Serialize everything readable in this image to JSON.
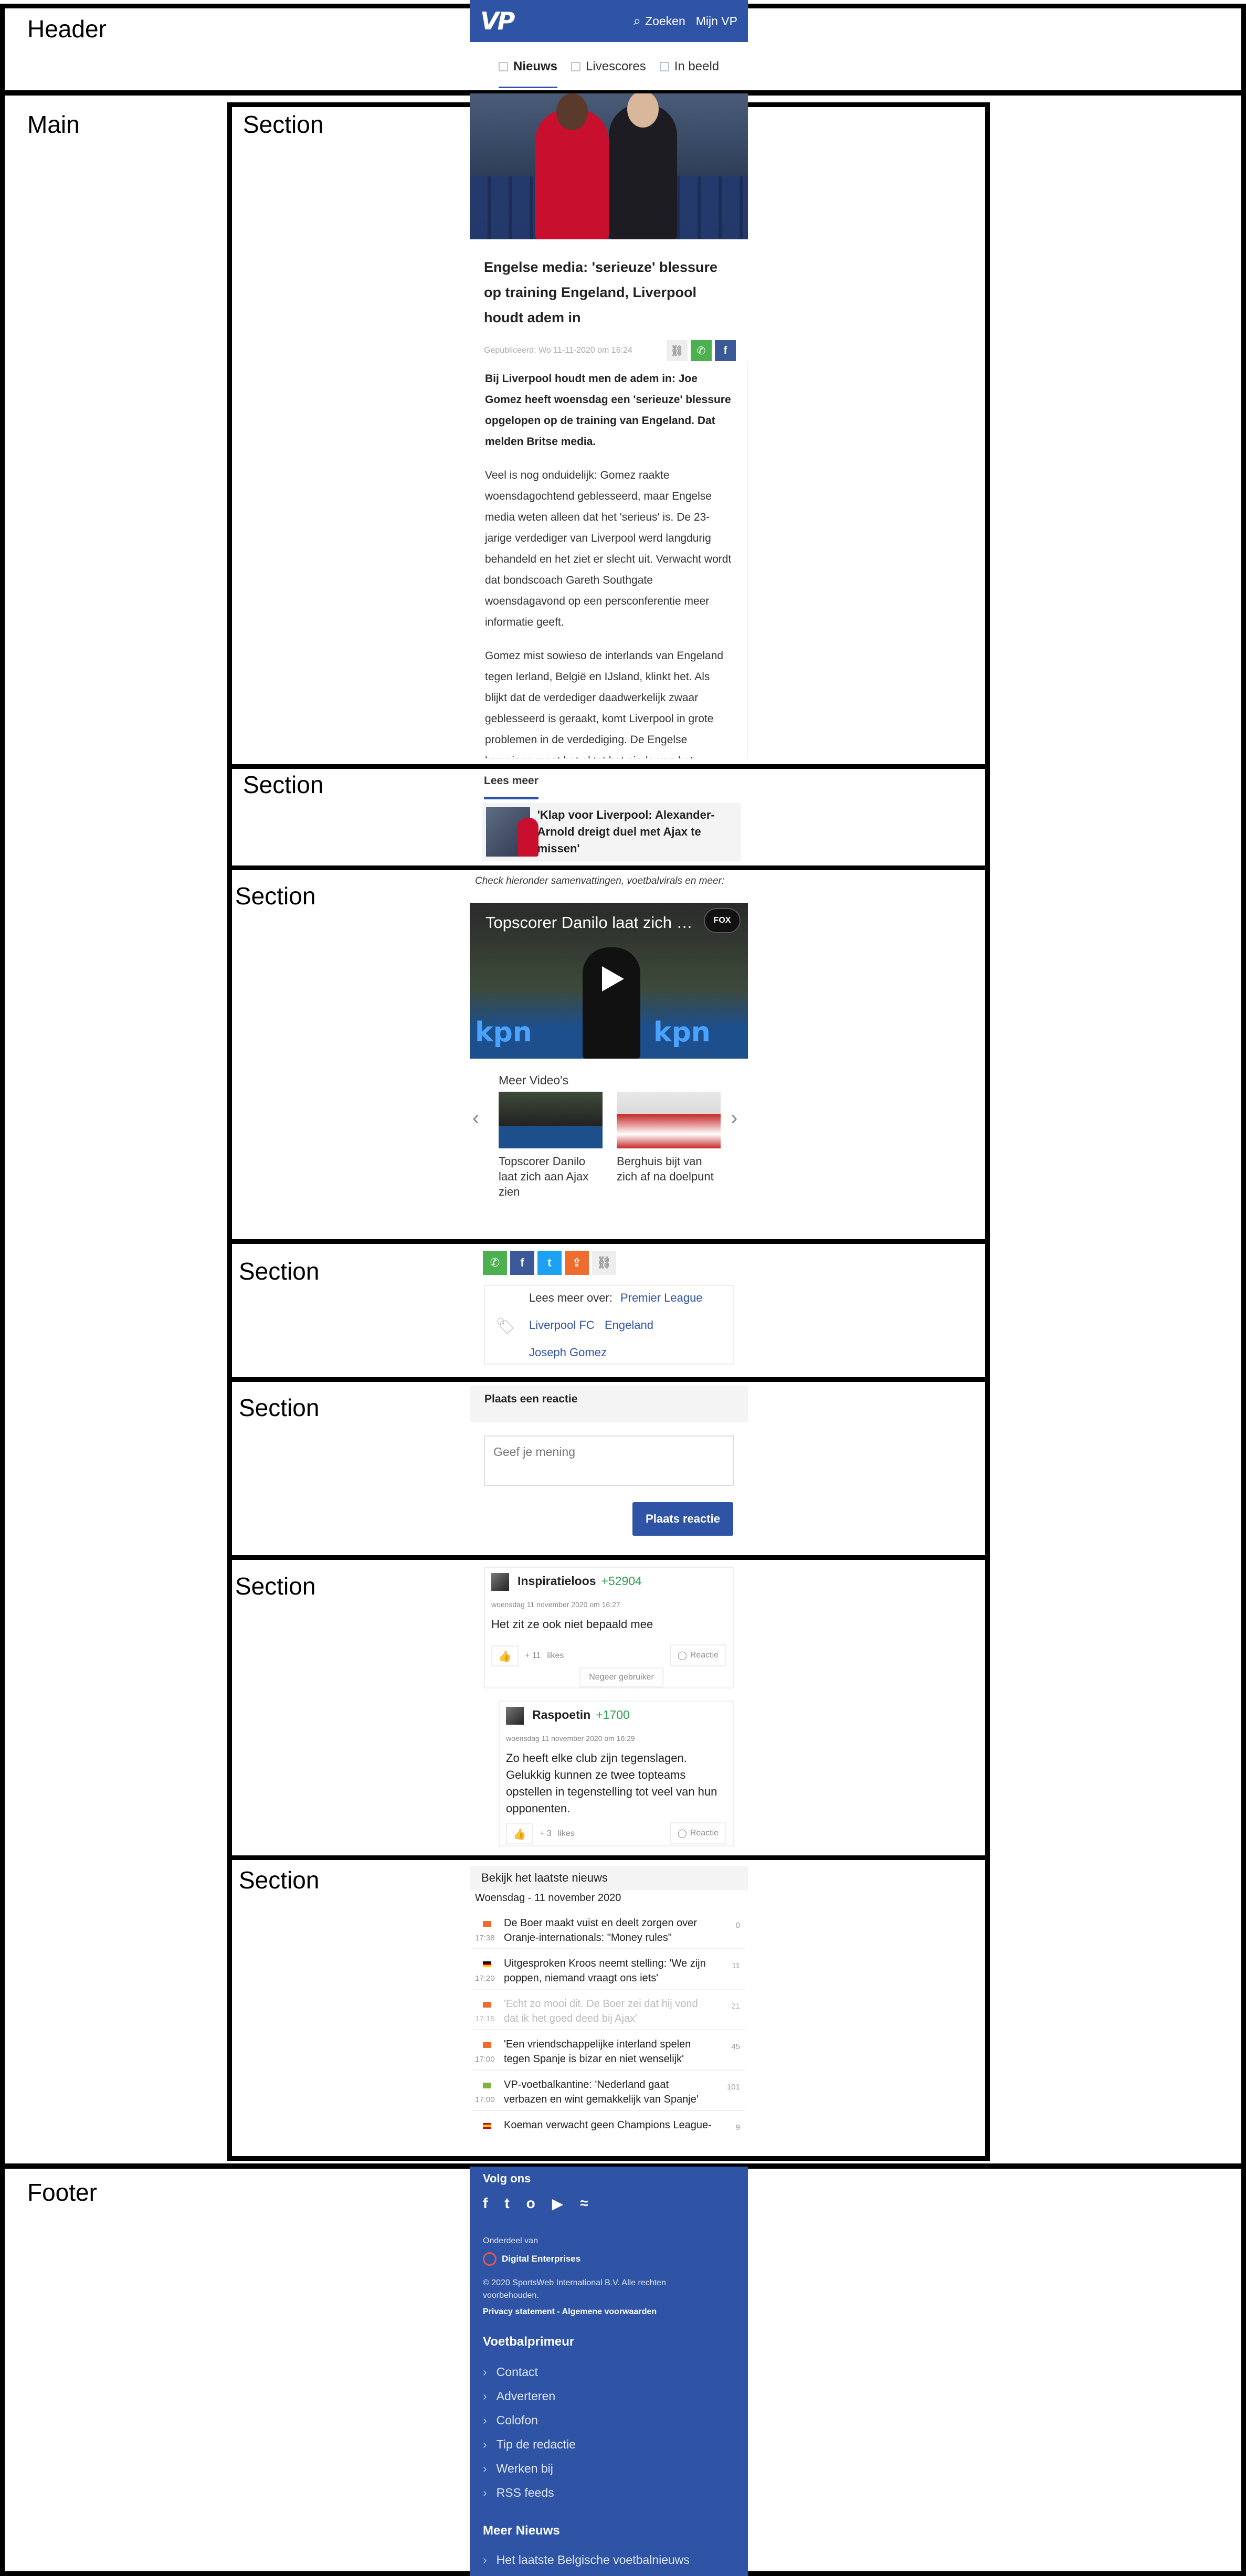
{
  "regions": {
    "header": "Header",
    "main": "Main",
    "section": "Section",
    "footer": "Footer"
  },
  "header": {
    "logo": "VP",
    "search_label": "Zoeken",
    "account_label": "Mijn VP",
    "tabs": [
      {
        "label": "Nieuws",
        "icon": "news-icon"
      },
      {
        "label": "Livescores",
        "icon": "livescores-icon"
      },
      {
        "label": "In beeld",
        "icon": "image-icon"
      }
    ]
  },
  "article": {
    "title": "Engelse media: 'serieuze' blessure op training Engeland, Liverpool houdt adem in",
    "date": "Gepubliceerd: Wo 11-11-2020 om 16:24",
    "paragraphs": [
      "Bij Liverpool houdt men de adem in: Joe Gomez heeft woensdag een 'serieuze' blessure opgelopen op de training van Engeland. Dat melden Britse media.",
      "Veel is nog onduidelijk: Gomez raakte woensdagochtend geblesseerd, maar Engelse media weten alleen dat het 'serieus' is. De 23-jarige verdediger van Liverpool werd langdurig behandeld en het ziet er slecht uit. Verwacht wordt dat bondscoach Gareth Southgate woensdagavond op een persconferentie meer informatie geeft.",
      "Gomez mist sowieso de interlands van Engeland tegen Ierland, België en IJsland, klinkt het. Als blijkt dat de verdediger daadwerkelijk zwaar geblesseerd is geraakt, komt Liverpool in grote problemen in de verdediging. De Engelse kampioen moet het al tot het einde van het"
    ]
  },
  "lees_meer": {
    "title": "Lees meer",
    "card_text": "'Klap voor Liverpool: Alexander-Arnold dreigt duel met Ajax te missen'"
  },
  "video": {
    "caption": "Check hieronder samenvattingen, voetbalvirals en meer:",
    "title": "Topscorer Danilo laat zich aan Ajax zien",
    "fox_label": "FOX",
    "sponsor": "kpn",
    "more_title": "Meer Video's",
    "items": [
      {
        "label": "Topscorer Danilo laat zich aan Ajax zien"
      },
      {
        "label": "Berghuis bijt van zich af na doelpunt"
      }
    ]
  },
  "tags": {
    "label": "Lees meer over:",
    "items": [
      "Premier League",
      "Liverpool FC",
      "Engeland",
      "Joseph Gomez"
    ]
  },
  "reaction": {
    "title": "Plaats een reactie",
    "placeholder": "Geef je mening",
    "button": "Plaats reactie"
  },
  "comments": [
    {
      "name": "Inspiratieloos",
      "score": "+52904",
      "date": "woensdag 11 november 2020 om 16:27",
      "text": "Het zit ze ook niet bepaald mee",
      "likes": "+ 11",
      "likes_label": "likes",
      "reply": "Reactie",
      "ignore": "Negeer gebruiker"
    },
    {
      "name": "Raspoetin",
      "score": "+1700",
      "date": "woensdag 11 november 2020 om 16:29",
      "text": "Zo heeft elke club zijn tegenslagen. Gelukkig kunnen ze twee topteams opstellen in tegenstelling tot veel van hun opponenten.",
      "likes": "+ 3",
      "likes_label": "likes",
      "reply": "Reactie"
    }
  ],
  "news": {
    "title": "Bekijk het laatste nieuws",
    "date": "Woensdag - 11 november 2020",
    "items": [
      {
        "time": "17:38",
        "text": "De Boer maakt vuist en deelt zorgen over Oranje-internationals: \"Money rules\"",
        "count": "0",
        "flag": "nl",
        "faded": false
      },
      {
        "time": "17:20",
        "text": "Uitgesproken Kroos neemt stelling: 'We zijn poppen, niemand vraagt ons iets'",
        "count": "11",
        "flag": "de",
        "faded": false
      },
      {
        "time": "17:15",
        "text": "'Echt zo mooi dit. De Boer zei dat hij vond dat ik het goed deed bij Ajax'",
        "count": "21",
        "flag": "nl",
        "faded": true
      },
      {
        "time": "17:00",
        "text": "'Een vriendschappelijke interland spelen tegen Spanje is bizar en niet wenselijk'",
        "count": "45",
        "flag": "nl",
        "faded": false
      },
      {
        "time": "17:00",
        "text": "VP-voetbalkantine: 'Nederland gaat verbazen en wint gemakkelijk van Spanje'",
        "count": "101",
        "flag": "vp",
        "faded": false
      },
      {
        "time": "",
        "text": "Koeman verwacht geen Champions League-",
        "count": "9",
        "flag": "es",
        "faded": false
      }
    ]
  },
  "footer": {
    "follow_title": "Volg ons",
    "social": [
      "f",
      "t",
      "o",
      "▶",
      "≈"
    ],
    "part_of": "Onderdeel van",
    "company": "Digital Enterprises",
    "copyright": "© 2020 SportsWeb International B.V. Alle rechten voorbehouden.",
    "legal_links": "Privacy statement - Algemene voorwaarden",
    "section1_title": "Voetbalprimeur",
    "section1_items": [
      "Contact",
      "Adverteren",
      "Colofon",
      "Tip de redactie",
      "Werken bij",
      "RSS feeds"
    ],
    "section2_title": "Meer Nieuws",
    "section2_items": [
      "Het laatste Belgische voetbalnieuws"
    ]
  },
  "colors": {
    "brand_blue": "#2f54a6",
    "whatsapp": "#4caf50",
    "facebook": "#3b5998",
    "twitter": "#1da1f2",
    "score_green": "#2e9e4f"
  }
}
